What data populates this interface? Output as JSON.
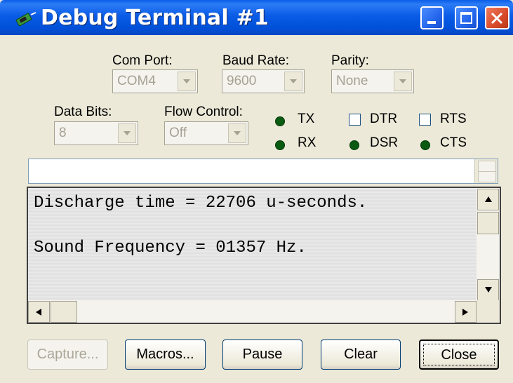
{
  "window": {
    "title": "Debug Terminal #1",
    "icon": "debug-terminal-app-icon",
    "controls": [
      "minimize-icon",
      "maximize-icon",
      "close-icon"
    ],
    "accent": "#0a5ee8",
    "face": "#ECE9D8"
  },
  "settings": {
    "com_port": {
      "label": "Com Port:",
      "value": "COM4"
    },
    "baud_rate": {
      "label": "Baud Rate:",
      "value": "9600"
    },
    "parity": {
      "label": "Parity:",
      "value": "None"
    },
    "data_bits": {
      "label": "Data Bits:",
      "value": "8"
    },
    "flow_control": {
      "label": "Flow Control:",
      "value": "Off"
    }
  },
  "indicators": {
    "tx": "TX",
    "rx": "RX",
    "dsr": "DSR",
    "cts": "CTS",
    "led_color": "#0a5a12"
  },
  "checkboxes": {
    "dtr": {
      "label": "DTR",
      "checked": false
    },
    "rts": {
      "label": "RTS",
      "checked": false
    }
  },
  "terminal": {
    "transmit_value": "",
    "lines": [
      "Discharge time = 22706 u-seconds.",
      "",
      "Sound Frequency = 01357 Hz."
    ]
  },
  "buttons": {
    "capture": "Capture...",
    "macros": "Macros...",
    "pause": "Pause",
    "clear": "Clear",
    "close": "Close"
  }
}
